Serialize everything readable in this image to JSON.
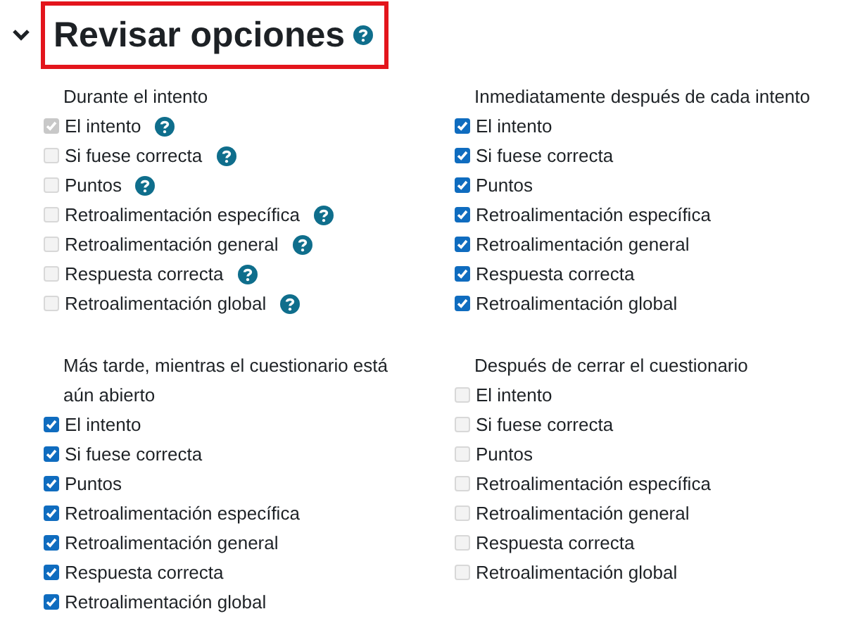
{
  "section": {
    "title": "Revisar opciones",
    "expanded": true,
    "help": true,
    "highlighted": true
  },
  "groups": [
    {
      "heading": "Durante el intento",
      "items": [
        {
          "label": "El intento",
          "checked": true,
          "disabled": true,
          "help": true
        },
        {
          "label": "Si fuese correcta",
          "checked": false,
          "disabled": true,
          "help": true
        },
        {
          "label": "Puntos",
          "checked": false,
          "disabled": true,
          "help": true
        },
        {
          "label": "Retroalimentación específica",
          "checked": false,
          "disabled": true,
          "help": true
        },
        {
          "label": "Retroalimentación general",
          "checked": false,
          "disabled": true,
          "help": true
        },
        {
          "label": "Respuesta correcta",
          "checked": false,
          "disabled": true,
          "help": true
        },
        {
          "label": "Retroalimentación global",
          "checked": false,
          "disabled": true,
          "help": true
        }
      ]
    },
    {
      "heading": "Inmediatamente después de cada intento",
      "items": [
        {
          "label": "El intento",
          "checked": true,
          "disabled": false,
          "help": false
        },
        {
          "label": "Si fuese correcta",
          "checked": true,
          "disabled": false,
          "help": false
        },
        {
          "label": "Puntos",
          "checked": true,
          "disabled": false,
          "help": false
        },
        {
          "label": "Retroalimentación específica",
          "checked": true,
          "disabled": false,
          "help": false
        },
        {
          "label": "Retroalimentación general",
          "checked": true,
          "disabled": false,
          "help": false
        },
        {
          "label": "Respuesta correcta",
          "checked": true,
          "disabled": false,
          "help": false
        },
        {
          "label": "Retroalimentación global",
          "checked": true,
          "disabled": false,
          "help": false
        }
      ]
    },
    {
      "heading": "Más tarde, mientras el cuestionario está aún abierto",
      "items": [
        {
          "label": "El intento",
          "checked": true,
          "disabled": false,
          "help": false
        },
        {
          "label": "Si fuese correcta",
          "checked": true,
          "disabled": false,
          "help": false
        },
        {
          "label": "Puntos",
          "checked": true,
          "disabled": false,
          "help": false
        },
        {
          "label": "Retroalimentación específica",
          "checked": true,
          "disabled": false,
          "help": false
        },
        {
          "label": "Retroalimentación general",
          "checked": true,
          "disabled": false,
          "help": false
        },
        {
          "label": "Respuesta correcta",
          "checked": true,
          "disabled": false,
          "help": false
        },
        {
          "label": "Retroalimentación global",
          "checked": true,
          "disabled": false,
          "help": false
        }
      ]
    },
    {
      "heading": "Después de cerrar el cuestionario",
      "items": [
        {
          "label": "El intento",
          "checked": false,
          "disabled": true,
          "help": false
        },
        {
          "label": "Si fuese correcta",
          "checked": false,
          "disabled": true,
          "help": false
        },
        {
          "label": "Puntos",
          "checked": false,
          "disabled": true,
          "help": false
        },
        {
          "label": "Retroalimentación específica",
          "checked": false,
          "disabled": true,
          "help": false
        },
        {
          "label": "Retroalimentación general",
          "checked": false,
          "disabled": true,
          "help": false
        },
        {
          "label": "Respuesta correcta",
          "checked": false,
          "disabled": true,
          "help": false
        },
        {
          "label": "Retroalimentación global",
          "checked": false,
          "disabled": true,
          "help": false
        }
      ]
    }
  ]
}
